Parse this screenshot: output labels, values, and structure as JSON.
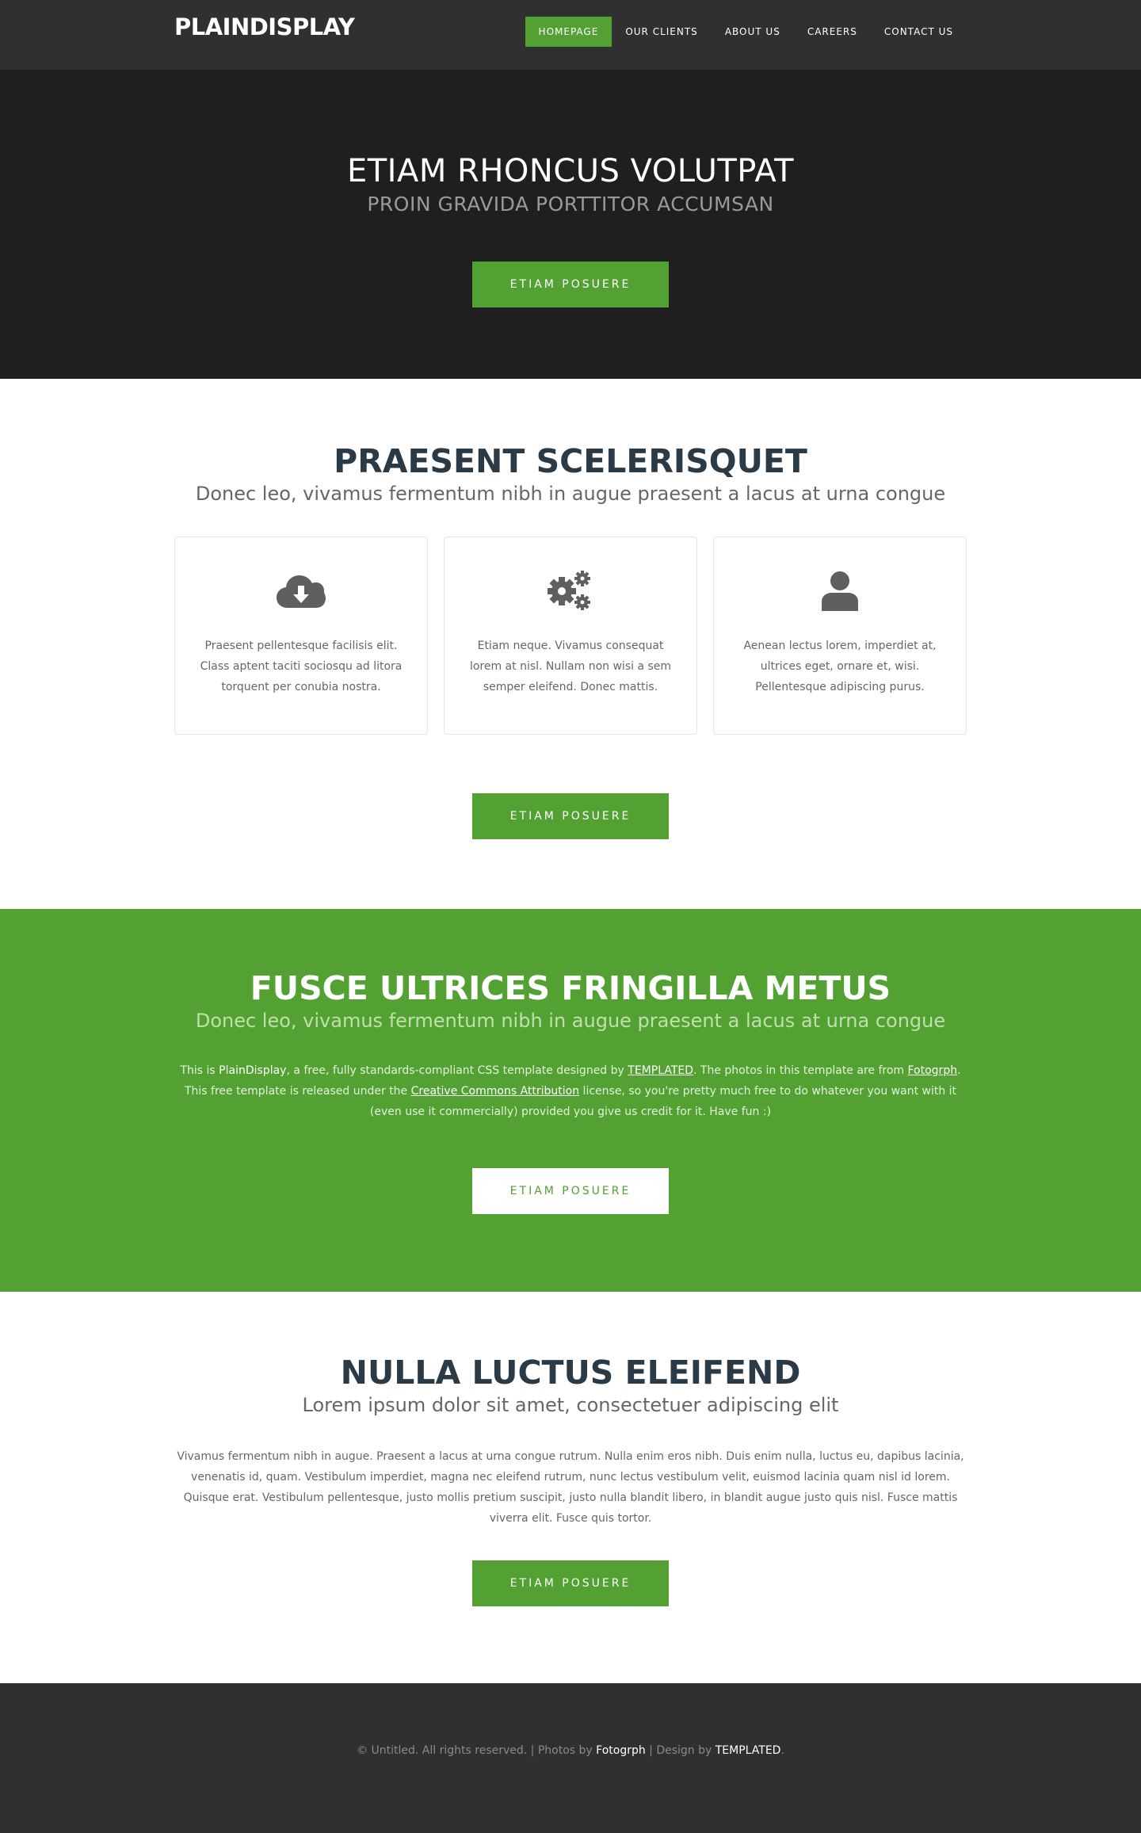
{
  "header": {
    "logo": "PLAINDISPLAY",
    "nav": [
      {
        "label": "HOMEPAGE"
      },
      {
        "label": "OUR CLIENTS"
      },
      {
        "label": "ABOUT US"
      },
      {
        "label": "CAREERS"
      },
      {
        "label": "CONTACT US"
      }
    ]
  },
  "banner": {
    "title": "ETIAM RHONCUS VOLUTPAT",
    "subtitle": "PROIN GRAVIDA PORTTITOR ACCUMSAN",
    "button": "ETIAM POSUERE"
  },
  "one": {
    "title": "PRAESENT SCELERISQUET",
    "subtitle": "Donec leo, vivamus fermentum nibh in augue praesent a lacus at urna congue",
    "features": [
      {
        "icon": "cloud-download-icon",
        "text": "Praesent pellentesque facilisis elit. Class aptent taciti sociosqu ad litora torquent per conubia nostra."
      },
      {
        "icon": "gears-icon",
        "text": "Etiam neque. Vivamus consequat lorem at nisl. Nullam non wisi a sem semper eleifend. Donec mattis."
      },
      {
        "icon": "user-icon",
        "text": "Aenean lectus lorem, imperdiet at, ultrices eget, ornare et, wisi. Pellentesque adipiscing purus."
      }
    ],
    "button": "ETIAM POSUERE"
  },
  "two": {
    "title": "FUSCE ULTRICES FRINGILLA METUS",
    "subtitle": "Donec leo, vivamus fermentum nibh in augue praesent a lacus at urna congue",
    "body": {
      "t1": "This is ",
      "brand": "PlainDisplay",
      "t2": ", a free, fully standards-compliant CSS template designed by ",
      "link1": "TEMPLATED",
      "t3": ". The photos in this template are from ",
      "link2": "Fotogrph",
      "t4": ". This free template is released under the ",
      "link3": "Creative Commons Attribution",
      "t5": " license, so you're pretty much free to do whatever you want with it (even use it commercially) provided you give us credit for it. Have fun :)"
    },
    "button": "ETIAM POSUERE"
  },
  "three": {
    "title": "NULLA LUCTUS ELEIFEND",
    "subtitle": "Lorem ipsum dolor sit amet, consectetuer adipiscing elit",
    "body": "Vivamus fermentum nibh in augue. Praesent a lacus at urna congue rutrum. Nulla enim eros nibh. Duis enim nulla, luctus eu, dapibus lacinia, venenatis id, quam. Vestibulum imperdiet, magna nec eleifend rutrum, nunc lectus vestibulum velit, euismod lacinia quam nisl id lorem. Quisque erat. Vestibulum pellentesque, justo mollis pretium suscipit, justo nulla blandit libero, in blandit augue justo quis nisl. Fusce mattis viverra elit. Fusce quis tortor.",
    "button": "ETIAM POSUERE"
  },
  "footer": {
    "t1": "© Untitled. All rights reserved. | Photos by ",
    "link1": "Fotogrph",
    "t2": " | Design by ",
    "link2": "TEMPLATED",
    "t3": "."
  },
  "colors": {
    "accent": "#52a132",
    "header_bg": "#303030",
    "banner_bg": "#1f1f1f",
    "heading": "#2b3a47"
  }
}
